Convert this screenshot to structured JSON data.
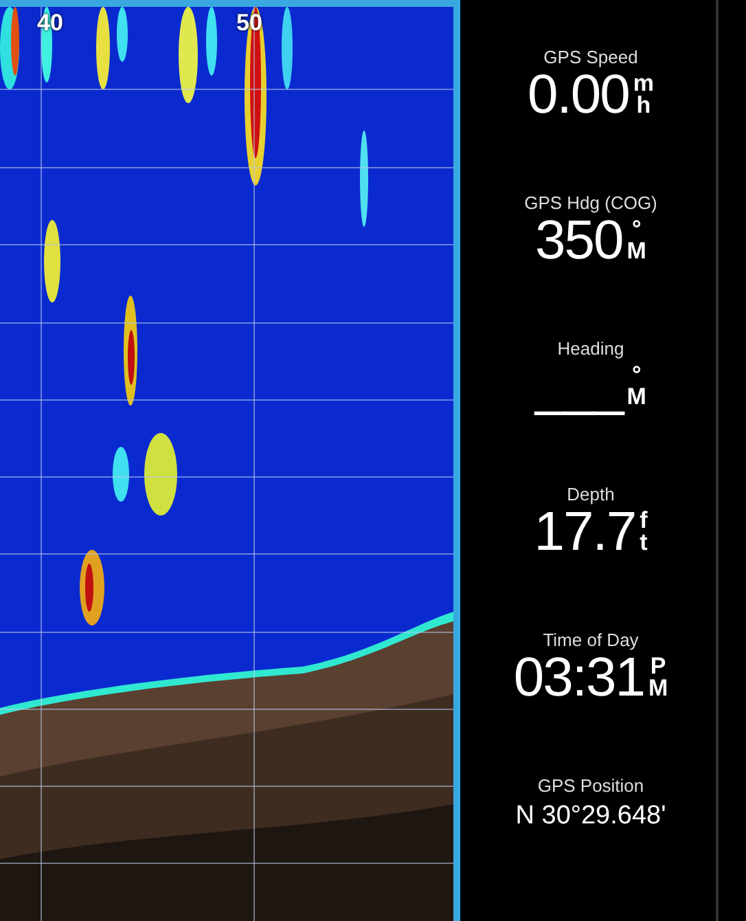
{
  "sonar": {
    "range_labels": [
      "40",
      "50"
    ]
  },
  "readouts": [
    {
      "label": "GPS Speed",
      "value": "0.00",
      "unit_top": "m",
      "unit_bottom": "h"
    },
    {
      "label": "GPS Hdg (COG)",
      "value": "350",
      "unit_top": "°",
      "unit_bottom": "M"
    },
    {
      "label": "Heading",
      "value": "___",
      "unit_top": "°",
      "unit_bottom": "M"
    },
    {
      "label": "Depth",
      "value": "17.7",
      "unit_top": "f",
      "unit_bottom": "t"
    },
    {
      "label": "Time of Day",
      "value": "03:31",
      "unit_top": "P",
      "unit_bottom": "M"
    },
    {
      "label": "GPS Position",
      "value": "N  30°29.648'"
    }
  ]
}
